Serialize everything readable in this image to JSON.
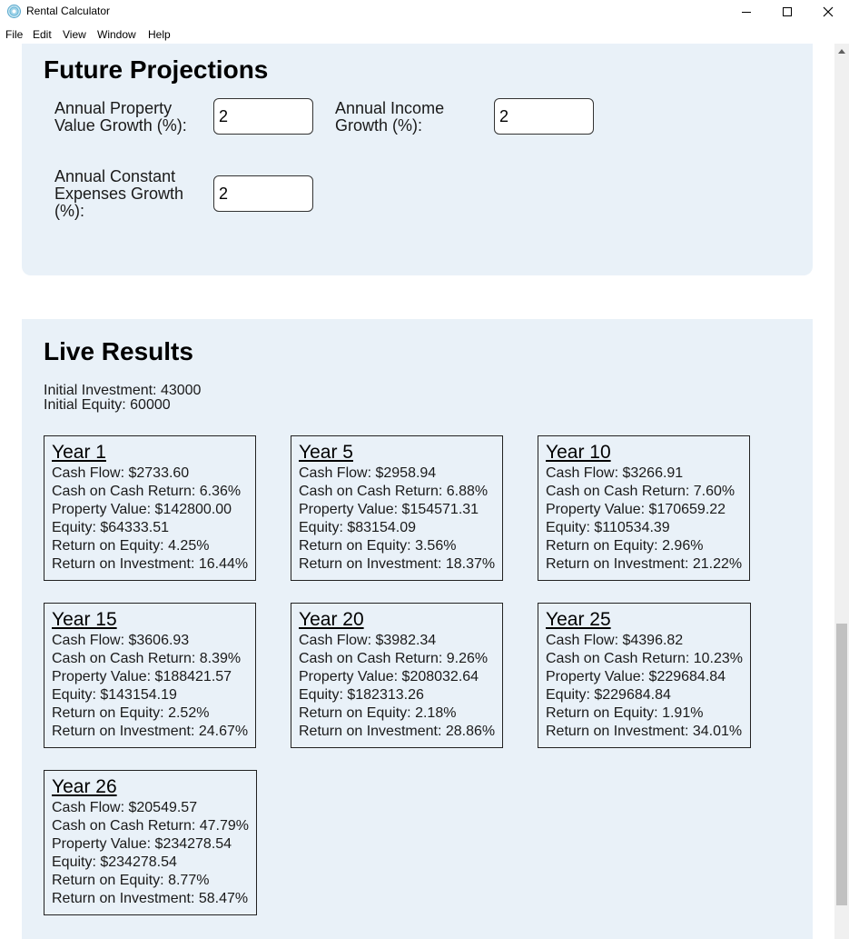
{
  "window": {
    "title": "Rental Calculator"
  },
  "menu": [
    "File",
    "Edit",
    "View",
    "Window",
    "Help"
  ],
  "projections": {
    "title": "Future Projections",
    "fields": {
      "property_growth": {
        "label": "Annual Property Value Growth (%):",
        "value": "2"
      },
      "income_growth": {
        "label": "Annual Income Growth (%):",
        "value": "2"
      },
      "expenses_growth": {
        "label": "Annual Constant Expenses Growth (%):",
        "value": "2"
      }
    }
  },
  "results": {
    "title": "Live Results",
    "initial_investment": "Initial Investment: 43000",
    "initial_equity": "Initial Equity: 60000",
    "cards": [
      {
        "year": "Year 1",
        "lines": [
          "Cash Flow: $2733.60",
          "Cash on Cash Return: 6.36%",
          "Property Value: $142800.00",
          "Equity: $64333.51",
          "Return on Equity: 4.25%",
          "Return on Investment: 16.44%"
        ]
      },
      {
        "year": "Year 5",
        "lines": [
          "Cash Flow: $2958.94",
          "Cash on Cash Return: 6.88%",
          "Property Value: $154571.31",
          "Equity: $83154.09",
          "Return on Equity: 3.56%",
          "Return on Investment: 18.37%"
        ]
      },
      {
        "year": "Year 10",
        "lines": [
          "Cash Flow: $3266.91",
          "Cash on Cash Return: 7.60%",
          "Property Value: $170659.22",
          "Equity: $110534.39",
          "Return on Equity: 2.96%",
          "Return on Investment: 21.22%"
        ]
      },
      {
        "year": "Year 15",
        "lines": [
          "Cash Flow: $3606.93",
          "Cash on Cash Return: 8.39%",
          "Property Value: $188421.57",
          "Equity: $143154.19",
          "Return on Equity: 2.52%",
          "Return on Investment: 24.67%"
        ]
      },
      {
        "year": "Year 20",
        "lines": [
          "Cash Flow: $3982.34",
          "Cash on Cash Return: 9.26%",
          "Property Value: $208032.64",
          "Equity: $182313.26",
          "Return on Equity: 2.18%",
          "Return on Investment: 28.86%"
        ]
      },
      {
        "year": "Year 25",
        "lines": [
          "Cash Flow: $4396.82",
          "Cash on Cash Return: 10.23%",
          "Property Value: $229684.84",
          "Equity: $229684.84",
          "Return on Equity: 1.91%",
          "Return on Investment: 34.01%"
        ]
      },
      {
        "year": "Year 26",
        "lines": [
          "Cash Flow: $20549.57",
          "Cash on Cash Return: 47.79%",
          "Property Value: $234278.54",
          "Equity: $234278.54",
          "Return on Equity: 8.77%",
          "Return on Investment: 58.47%"
        ]
      }
    ]
  }
}
